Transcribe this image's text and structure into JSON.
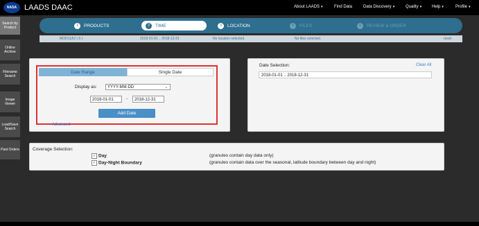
{
  "header": {
    "logo_text": "NASA",
    "app_title": "LAADS DAAC",
    "nav": [
      {
        "label": "About LAADS",
        "dropdown": true
      },
      {
        "label": "Find Data",
        "dropdown": false
      },
      {
        "label": "Data Discovery",
        "dropdown": true
      },
      {
        "label": "Quality",
        "dropdown": true
      },
      {
        "label": "Help",
        "dropdown": true
      },
      {
        "label": "Profile",
        "dropdown": true
      }
    ]
  },
  "sidebar": {
    "items": [
      {
        "label": "Search by Product",
        "active": true
      },
      {
        "label": "Online Archive"
      },
      {
        "label": "Filename Search"
      },
      {
        "label": "Image Viewer"
      },
      {
        "label": "Load/Save Search"
      },
      {
        "label": "Past Orders"
      }
    ]
  },
  "steps": [
    {
      "num": "1",
      "label": "PRODUCTS",
      "state": "done"
    },
    {
      "num": "2",
      "label": "TIME",
      "state": "active"
    },
    {
      "num": "3",
      "label": "LOCATION",
      "state": "done"
    },
    {
      "num": "4",
      "label": "FILES",
      "state": "pending"
    },
    {
      "num": "5",
      "label": "REVIEW & ORDER",
      "state": "pending"
    }
  ],
  "summary": {
    "product": "MOD11A2 ( 6 )",
    "time": "2018-01-01 .. 2018-12-31",
    "location": "No location selected.",
    "files": "No files selected.",
    "reset": "reset"
  },
  "date_range": {
    "tab_range": "Date Range",
    "tab_single": "Single Date",
    "display_label": "Display as:",
    "display_value": "YYYY-MM-DD",
    "start": "2018-01-01",
    "separator": "-",
    "end": "2018-12-31",
    "add_button": "Add Date",
    "advanced": "+ Advanced"
  },
  "date_selection": {
    "title": "Date Selection:",
    "clear_all": "Clear All",
    "value": "2018-01-01 .. 2018-12-31"
  },
  "coverage": {
    "title": "Coverage Selection:",
    "options": [
      {
        "label": "Day",
        "checked": true,
        "desc": "(granules contain day data only)"
      },
      {
        "label": "Day-Night Boundary",
        "checked": true,
        "desc": "(granules contain data over the seasonal, latitude boundary between day and night)"
      }
    ]
  }
}
